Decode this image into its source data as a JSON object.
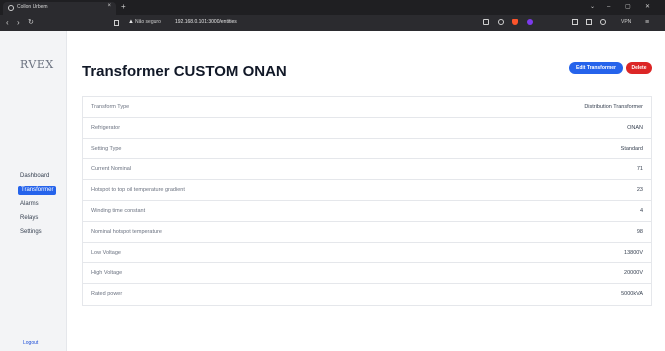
{
  "browser": {
    "tab_title": "Collon Urbem",
    "tab_close_icon": "close-icon",
    "new_tab_icon": "plus-icon",
    "security_warning": "Não seguro",
    "url": "192.168.0.101:3000/entities",
    "vpn_label": "VPN",
    "window_controls": [
      "chevron-down-icon",
      "minimize-icon",
      "maximize-icon",
      "close-icon"
    ]
  },
  "sidebar": {
    "logo": "RVEX",
    "items": [
      {
        "label": "Dashboard",
        "active": false
      },
      {
        "label": "Transformer",
        "active": true
      },
      {
        "label": "Alarms",
        "active": false
      },
      {
        "label": "Relays",
        "active": false
      },
      {
        "label": "Settings",
        "active": false
      }
    ],
    "logout": "Logout"
  },
  "header": {
    "title": "Transformer CUSTOM ONAN",
    "edit_label": "Edit Transformer",
    "delete_label": "Delete"
  },
  "details": [
    {
      "label": "Transform Type",
      "value": "Distribution Transformer"
    },
    {
      "label": "Refrigerator",
      "value": "ONAN"
    },
    {
      "label": "Setting Type",
      "value": "Standard"
    },
    {
      "label": "Current Nominal",
      "value": "71"
    },
    {
      "label": "Hotspot to top oil temperature gradient",
      "value": "23"
    },
    {
      "label": "Winding time constant",
      "value": "4"
    },
    {
      "label": "Nominal hotspot temperature",
      "value": "98"
    },
    {
      "label": "Low Voltage",
      "value": "13800V"
    },
    {
      "label": "High Voltage",
      "value": "20000V"
    },
    {
      "label": "Rated power",
      "value": "5000kVA"
    }
  ],
  "colors": {
    "primary": "#2563eb",
    "danger": "#dc2626",
    "chrome": "#2b2b2f"
  }
}
